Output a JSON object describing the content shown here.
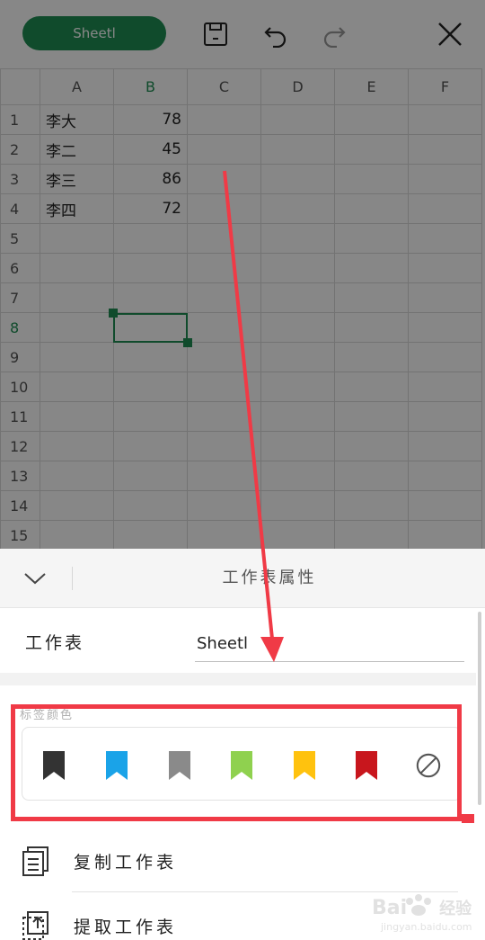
{
  "toolbar": {
    "sheet_name": "Sheetl",
    "accent": "#1f8f54"
  },
  "grid": {
    "columns": [
      "A",
      "B",
      "C",
      "D",
      "E",
      "F"
    ],
    "rows": [
      "1",
      "2",
      "3",
      "4",
      "5",
      "6",
      "7",
      "8",
      "9",
      "10",
      "11",
      "12",
      "13",
      "14",
      "15"
    ],
    "data": [
      [
        "李大",
        "78"
      ],
      [
        "李二",
        "45"
      ],
      [
        "李三",
        "86"
      ],
      [
        "李四",
        "72"
      ]
    ],
    "selected_column": "B",
    "selected_row": "8"
  },
  "panel": {
    "title": "工作表属性",
    "name_label": "工作表",
    "name_value": "Sheetl",
    "tag_caption": "标签颜色",
    "tag_colors": [
      {
        "name": "black",
        "color": "#333333"
      },
      {
        "name": "blue",
        "color": "#1aa3e8"
      },
      {
        "name": "gray",
        "color": "#8a8a8a"
      },
      {
        "name": "green",
        "color": "#8fd14f"
      },
      {
        "name": "yellow",
        "color": "#ffc20e"
      },
      {
        "name": "red",
        "color": "#c8161d"
      },
      {
        "name": "none",
        "color": "#555555"
      }
    ],
    "actions": [
      {
        "label": "复制工作表",
        "icon": "copy-sheet-icon"
      },
      {
        "label": "提取工作表",
        "icon": "extract-sheet-icon"
      }
    ]
  },
  "watermark": {
    "brand": "Bai",
    "suffix": "经验",
    "domain": "jingyan.baidu.com"
  },
  "annotation_color": "#f03a46"
}
